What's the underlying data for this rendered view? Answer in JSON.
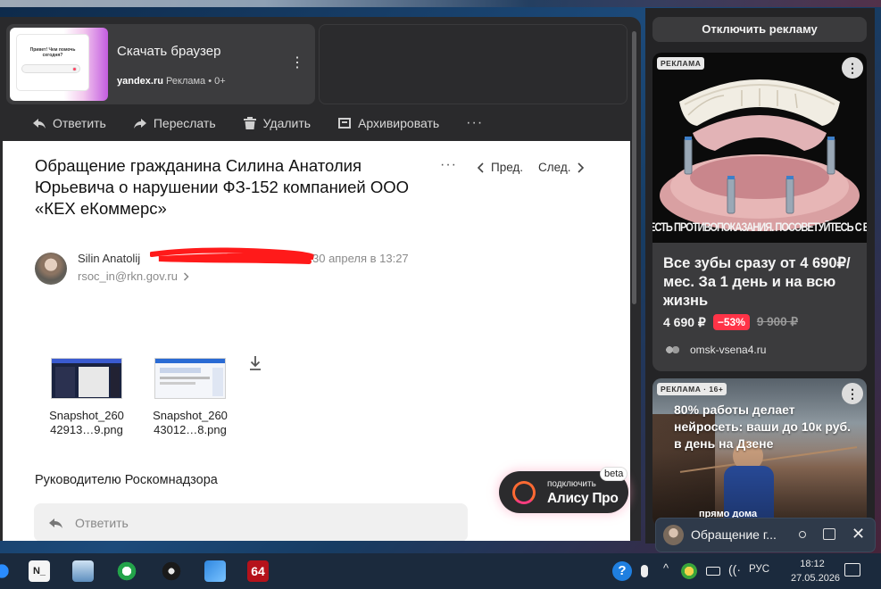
{
  "colors": {
    "accent_red": "#ff3347",
    "alice_orange": "#ff6a33",
    "dark_panel": "#2a2a2c"
  },
  "top_ad": {
    "title": "Скачать браузер",
    "domain": "yandex.ru",
    "label": "Реклама",
    "age": "0+",
    "thumb_text": "Привет! Чем помочь сегодня?"
  },
  "toolbar": {
    "reply": "Ответить",
    "forward": "Переслать",
    "delete": "Удалить",
    "archive": "Архивировать",
    "more": "···"
  },
  "message": {
    "subject": "Обращение гражданина Силина Анатолия Юрьевича о нарушении ФЗ-152 компанией ООО «КЕХ еКоммерс»",
    "more": "···",
    "prev": "Пред.",
    "next": "След.",
    "sender_name": "Silin Anatolij",
    "date": "30 апреля в 13:27",
    "recipient": "rsoc_in@rkn.gov.ru",
    "attachments": [
      {
        "name": "Snapshot_260 42913…9.png"
      },
      {
        "name": "Snapshot_260 43012…8.png"
      }
    ],
    "greeting": "Руководителю Роскомнадзора",
    "reply_placeholder": "Ответить"
  },
  "alice": {
    "small": "подключить",
    "big": "Алису Про",
    "beta": "beta"
  },
  "right_panel": {
    "disable_ads": "Отключить рекламу",
    "card1": {
      "badge": "РЕКЛАМА",
      "more": "⋮",
      "warning": "ЕСТЬ ПРОТИВОПОКАЗАНИЯ. ПОСОВЕТУЙТЕСЬ С ВРАЧОМ",
      "title": "Все зубы сразу от 4 690₽/мес. За 1 день и на всю жизнь",
      "price": "4 690 ₽",
      "discount": "−53%",
      "old_price": "9 900 ₽",
      "domain": "omsk-vsena4.ru"
    },
    "card2": {
      "badge": "РЕКЛАМА · 16+",
      "more": "⋮",
      "title": "80% работы делает нейросеть: ваши до 10к руб. в день на Дзене",
      "footer": "прямо дома"
    }
  },
  "mini_window": {
    "title": "Обращение г..."
  },
  "taskbar": {
    "app_label_1": "N_",
    "app_label_6": "64",
    "help": "?",
    "lang": "РУС",
    "time": "18:12",
    "date": "27.05.2026"
  }
}
